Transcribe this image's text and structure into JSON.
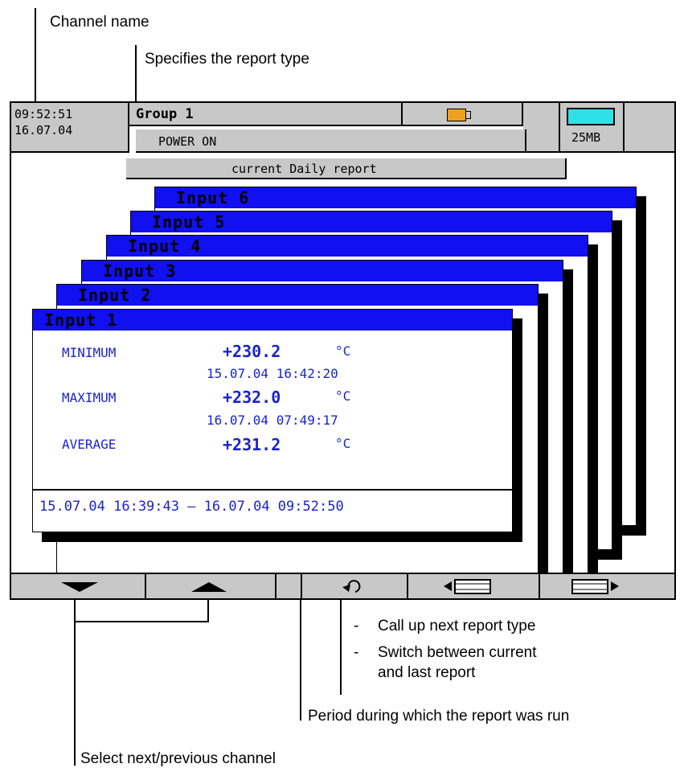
{
  "annotations": {
    "channel_name": "Channel name",
    "report_type": "Specifies the report type",
    "next_report_dash1": "-",
    "next_report": "Call up next report type",
    "switch_dash": "-",
    "switch_line1": "Switch between current",
    "switch_line2": "and last report",
    "period": "Period during which the report was run",
    "select_channel": "Select next/previous channel"
  },
  "header": {
    "time": "09:52:51",
    "date": "16.07.04",
    "group": "Group 1",
    "status": "POWER ON",
    "memory": "25MB",
    "report_type": "current Daily report"
  },
  "channels": [
    "Input 6",
    "Input 5",
    "Input 4",
    "Input 3",
    "Input 2",
    "Input 1"
  ],
  "report": {
    "minimum_label": "MINIMUM",
    "minimum_value": "+230.2",
    "minimum_unit": "°C",
    "minimum_time": "15.07.04 16:42:20",
    "maximum_label": "MAXIMUM",
    "maximum_value": "+232.0",
    "maximum_unit": "°C",
    "maximum_time": "16.07.04 07:49:17",
    "average_label": "AVERAGE",
    "average_value": "+231.2",
    "average_unit": "°C",
    "period": "15.07.04 16:39:43 — 16.07.04 09:52:50"
  },
  "softkeys": [
    "down-arrow-icon",
    "up-arrow-icon",
    "blank",
    "report-type-icon",
    "previous-page-icon",
    "next-page-icon"
  ],
  "colors": {
    "title_bar": "#1010f0",
    "text": "#1a24c8",
    "panel": "#c8c8c8",
    "battery": "#f0a020",
    "memory": "#30e0e8"
  }
}
